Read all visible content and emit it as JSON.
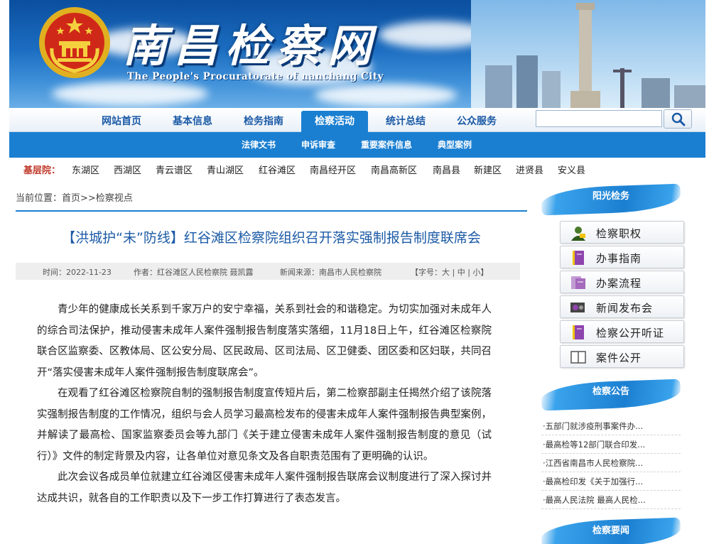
{
  "banner": {
    "title": "南昌检察网",
    "subtitle": "The People's Procuratorate of nanchang City"
  },
  "nav": {
    "items": [
      "网站首页",
      "基本信息",
      "检务指南",
      "检察活动",
      "统计总结",
      "公众服务"
    ],
    "active_index": 3,
    "search_placeholder": ""
  },
  "subnav": {
    "items": [
      "法律文书",
      "申诉审查",
      "重要案件信息",
      "典型案例"
    ]
  },
  "districts": {
    "label": "基层院：",
    "items": [
      "东湖区",
      "西湖区",
      "青云谱区",
      "青山湖区",
      "红谷滩区",
      "南昌经开区",
      "南昌高新区",
      "南昌县",
      "新建区",
      "进贤县",
      "安义县"
    ]
  },
  "breadcrumb": "当前位置：首页>>检察视点",
  "article": {
    "title": "【洪城护“未”防线】红谷滩区检察院组织召开落实强制报告制度联席会",
    "meta": {
      "time": "时间：2022-11-23",
      "author": "作者：红谷滩区人民检察院 聂凯露",
      "source": "新闻来源：南昌市人民检察院",
      "fontsize": "【字号：大 | 中 | 小】"
    },
    "paragraphs": [
      "青少年的健康成长关系到千家万户的安宁幸福，关系到社会的和谐稳定。为切实加强对未成年人的综合司法保护，推动侵害未成年人案件强制报告制度落实落细，11月18日上午，红谷滩区检察院联合区监察委、区教体局、区公安分局、区民政局、区司法局、区卫健委、团区委和区妇联，共同召开“落实侵害未成年人案件强制报告制度联席会”。",
      "在观看了红谷滩区检察院自制的强制报告制度宣传短片后，第二检察部副主任揭然介绍了该院落实强制报告制度的工作情况，组织与会人员学习最高检发布的侵害未成年人案件强制报告典型案例，并解读了最高检、国家监察委员会等九部门《关于建立侵害未成年人案件强制报告制度的意见（试行）》文件的制定背景及内容，让各单位对意见条文及各自职责范围有了更明确的认识。",
      "此次会议各成员单位就建立红谷滩区侵害未成年人案件强制报告联席会议制度进行了深入探讨并达成共识，就各自的工作职责以及下一步工作打算进行了表态发言。"
    ]
  },
  "sidebar": {
    "sunshine_heading": "阳光检务",
    "sunshine_items": [
      {
        "label": "检察职权",
        "icon": "person-icon"
      },
      {
        "label": "办事指南",
        "icon": "notebook-icon"
      },
      {
        "label": "办案流程",
        "icon": "flowchart-icon"
      },
      {
        "label": "新闻发布会",
        "icon": "film-icon"
      },
      {
        "label": "检察公开听证",
        "icon": "notebook-icon"
      },
      {
        "label": "案件公开",
        "icon": "book-icon"
      }
    ],
    "notice_heading": "检察公告",
    "notices": [
      "·五部门就涉疫刑事案件办...",
      "·最高检等12部门联合印发...",
      "·江西省南昌市人民检察院...",
      "·最高检印发《关于加强行...",
      "·最高人民法院 最高人民检..."
    ],
    "news_heading": "检察要闻"
  },
  "colors": {
    "primary_blue": "#1b7fd1",
    "title_blue": "#1b5aa6",
    "district_label_red": "#c0392b"
  }
}
